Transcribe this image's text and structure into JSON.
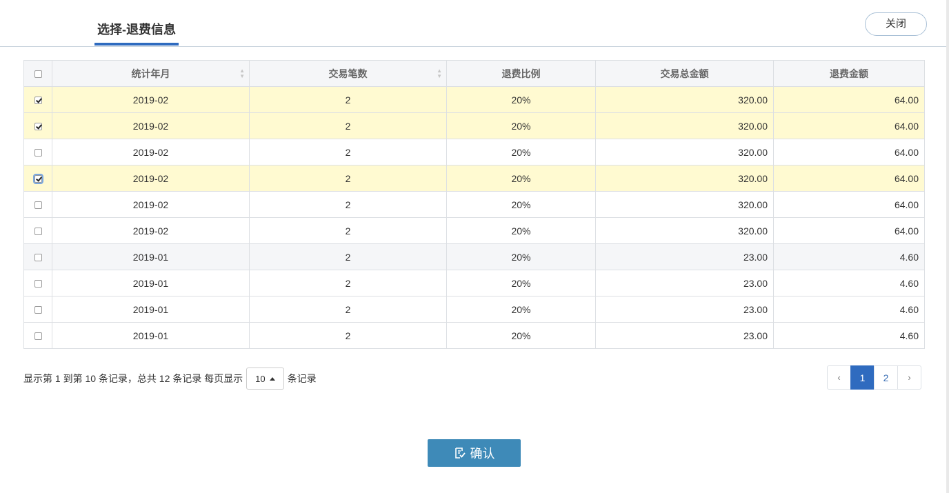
{
  "header": {
    "tab_title": "选择-退费信息",
    "close_label": "关闭"
  },
  "table": {
    "columns": [
      "统计年月",
      "交易笔数",
      "退费比例",
      "交易总金额",
      "退费金额"
    ],
    "rows": [
      {
        "checked": true,
        "month": "2019-02",
        "count": "2",
        "ratio": "20%",
        "total": "320.00",
        "refund": "64.00"
      },
      {
        "checked": true,
        "month": "2019-02",
        "count": "2",
        "ratio": "20%",
        "total": "320.00",
        "refund": "64.00"
      },
      {
        "checked": false,
        "month": "2019-02",
        "count": "2",
        "ratio": "20%",
        "total": "320.00",
        "refund": "64.00"
      },
      {
        "checked": true,
        "month": "2019-02",
        "count": "2",
        "ratio": "20%",
        "total": "320.00",
        "refund": "64.00"
      },
      {
        "checked": false,
        "month": "2019-02",
        "count": "2",
        "ratio": "20%",
        "total": "320.00",
        "refund": "64.00"
      },
      {
        "checked": false,
        "month": "2019-02",
        "count": "2",
        "ratio": "20%",
        "total": "320.00",
        "refund": "64.00"
      },
      {
        "checked": false,
        "month": "2019-01",
        "count": "2",
        "ratio": "20%",
        "total": "23.00",
        "refund": "4.60"
      },
      {
        "checked": false,
        "month": "2019-01",
        "count": "2",
        "ratio": "20%",
        "total": "23.00",
        "refund": "4.60"
      },
      {
        "checked": false,
        "month": "2019-01",
        "count": "2",
        "ratio": "20%",
        "total": "23.00",
        "refund": "4.60"
      },
      {
        "checked": false,
        "month": "2019-01",
        "count": "2",
        "ratio": "20%",
        "total": "23.00",
        "refund": "4.60"
      }
    ]
  },
  "pager": {
    "info_text": "显示第 1 到第 10 条记录，总共 12 条记录 每页显示",
    "page_size": "10",
    "suffix_text": "条记录",
    "prev": "‹",
    "next": "›",
    "pages": [
      "1",
      "2"
    ],
    "current_page": "1"
  },
  "confirm": {
    "label": "确认",
    "icon": "edit-check-icon",
    "color": "#3e8ab8"
  },
  "colors": {
    "accent": "#2f6bbf",
    "selected_row": "#fffad1"
  }
}
